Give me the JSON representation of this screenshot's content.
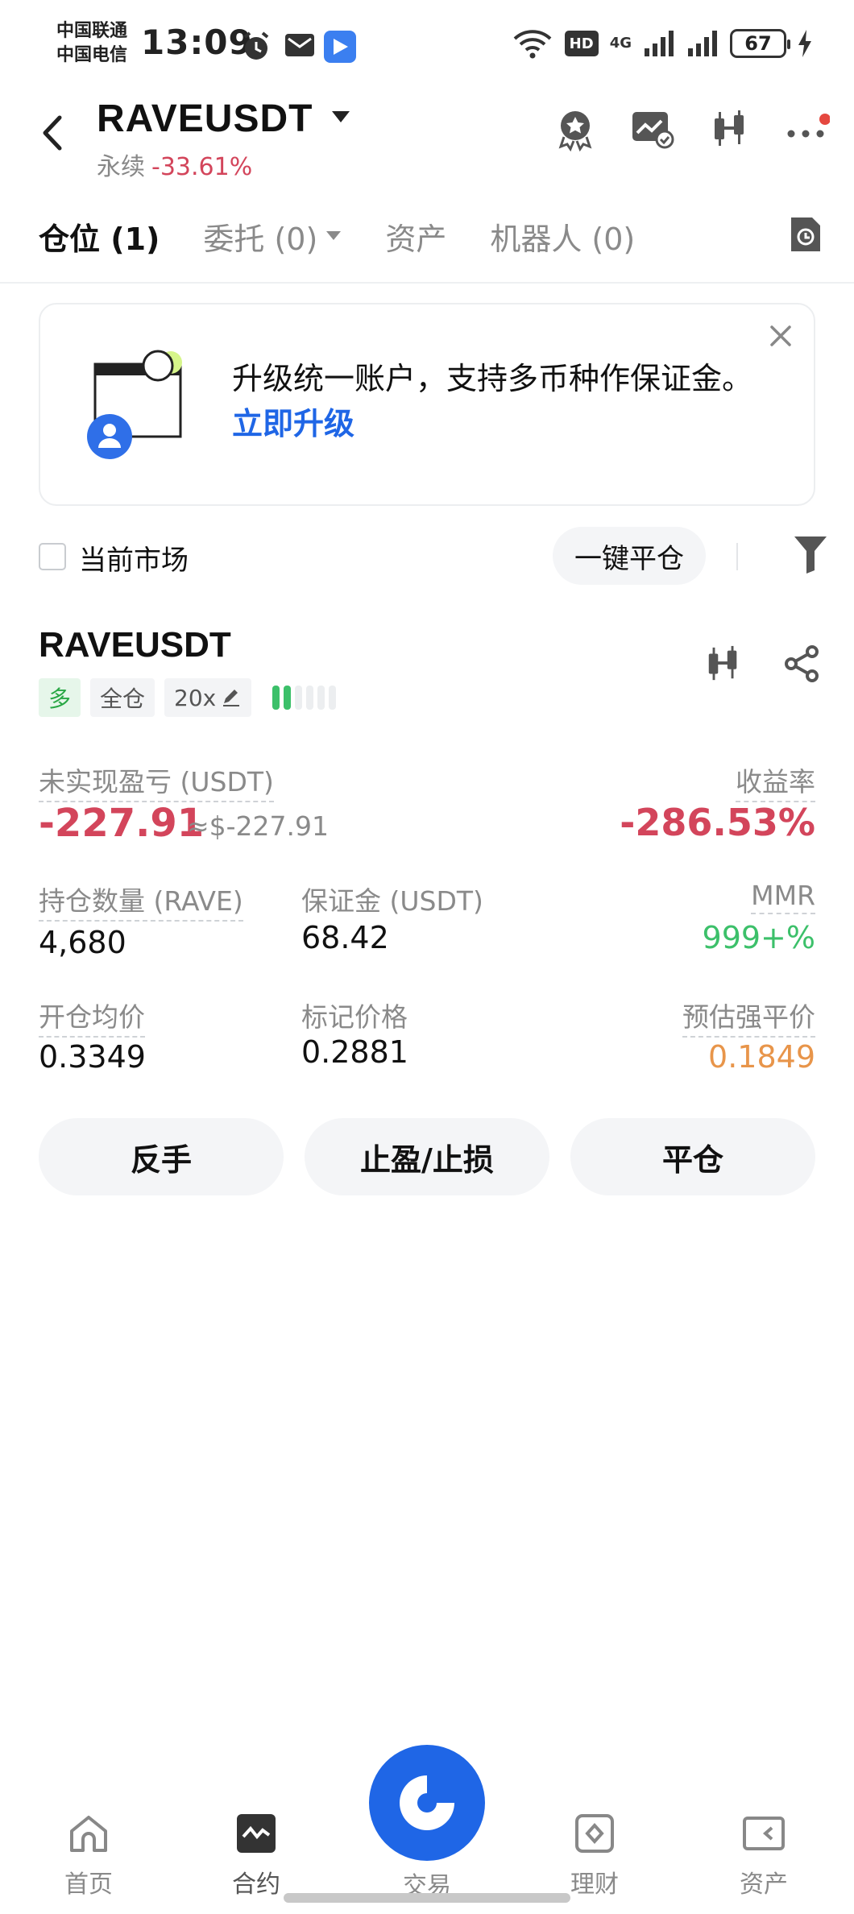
{
  "status_bar": {
    "carrier1": "中国联通",
    "carrier2": "中国电信",
    "time": "13:09",
    "network": "4G",
    "hd": "HD",
    "battery": "67"
  },
  "header": {
    "symbol": "RAVEUSDT",
    "type": "永续",
    "change": "-33.61%"
  },
  "tabs": [
    {
      "label": "仓位 (1)"
    },
    {
      "label": "委托 (0)"
    },
    {
      "label": "资产"
    },
    {
      "label": "机器人 (0)"
    }
  ],
  "banner": {
    "text": "升级统一账户，支持多币种作保证金。",
    "link": "立即升级"
  },
  "filter": {
    "current_market": "当前市场",
    "close_all": "一键平仓"
  },
  "position": {
    "symbol": "RAVEUSDT",
    "side": "多",
    "margin_mode": "全仓",
    "leverage": "20x",
    "risk_level": 0.33,
    "unrealized_pnl_label": "未实现盈亏 (USDT)",
    "unrealized_pnl": "-227.91",
    "unrealized_pnl_usd": "≈$-227.91",
    "roe_label": "收益率",
    "roe": "-286.53%",
    "size_label": "持仓数量 (RAVE)",
    "size": "4,680",
    "margin_label": "保证金 (USDT)",
    "margin": "68.42",
    "mmr_label": "MMR",
    "mmr": "999+%",
    "entry_label": "开仓均价",
    "entry": "0.3349",
    "mark_label": "标记价格",
    "mark": "0.2881",
    "liq_label": "预估强平价",
    "liq": "0.1849"
  },
  "actions": {
    "reverse": "反手",
    "tpsl": "止盈/止损",
    "close": "平仓"
  },
  "nav": {
    "home": "首页",
    "contract": "合约",
    "trade": "交易",
    "finance": "理财",
    "assets": "资产"
  },
  "colors": {
    "negative": "#d3455b",
    "positive": "#3cc06a",
    "warning": "#e8954a",
    "accent": "#1f66e6"
  }
}
